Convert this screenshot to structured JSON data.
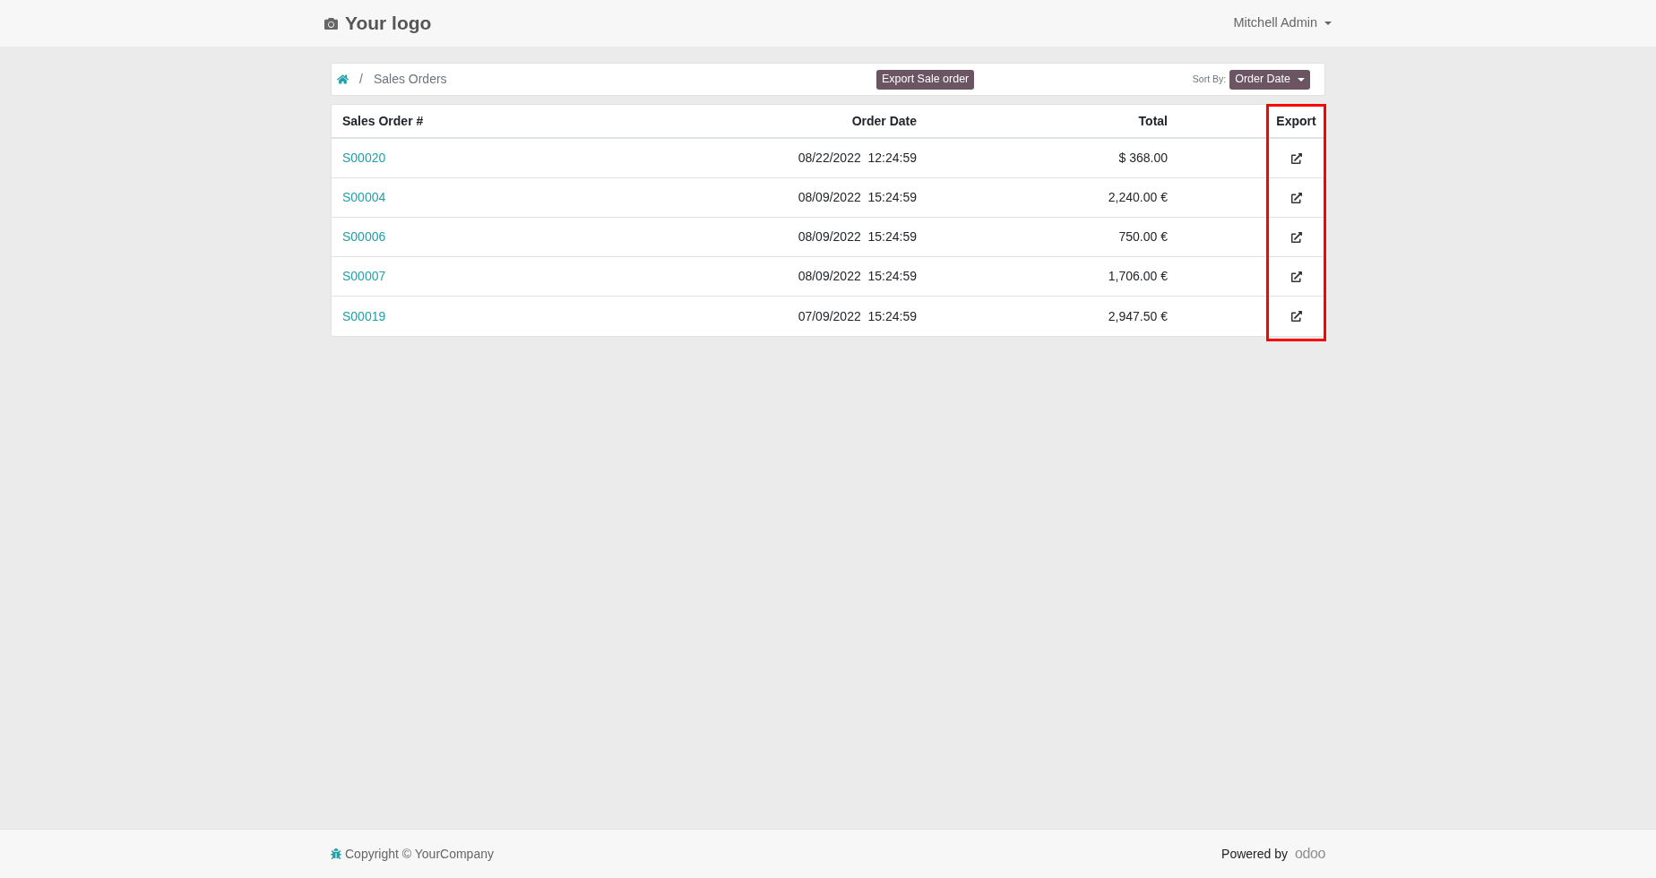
{
  "navbar": {
    "logo": "Your logo",
    "user": "Mitchell Admin"
  },
  "breadcrumb": {
    "separator": "/",
    "items": [
      "Sales Orders"
    ]
  },
  "toolbar": {
    "export_button": "Export Sale order",
    "sort_label": "Sort By:",
    "sort_value": "Order Date"
  },
  "table": {
    "columns": [
      {
        "label": "Sales Order #",
        "highlighted": false
      },
      {
        "label": "Order Date",
        "highlighted": false
      },
      {
        "label": "Total",
        "highlighted": false
      },
      {
        "label": "Export",
        "highlighted": true
      }
    ],
    "rows": [
      {
        "order": "S00020",
        "date": "08/22/2022  12:24:59",
        "total": "$ 368.00"
      },
      {
        "order": "S00004",
        "date": "08/09/2022  15:24:59",
        "total": "2,240.00 €"
      },
      {
        "order": "S00006",
        "date": "08/09/2022  15:24:59",
        "total": "750.00 €"
      },
      {
        "order": "S00007",
        "date": "08/09/2022  15:24:59",
        "total": "1,706.00 €"
      },
      {
        "order": "S00019",
        "date": "07/09/2022  15:24:59",
        "total": "2,947.50 €"
      }
    ]
  },
  "footer": {
    "copyright": "Copyright © YourCompany",
    "powered_by": "Powered by",
    "brand": "odoo"
  }
}
